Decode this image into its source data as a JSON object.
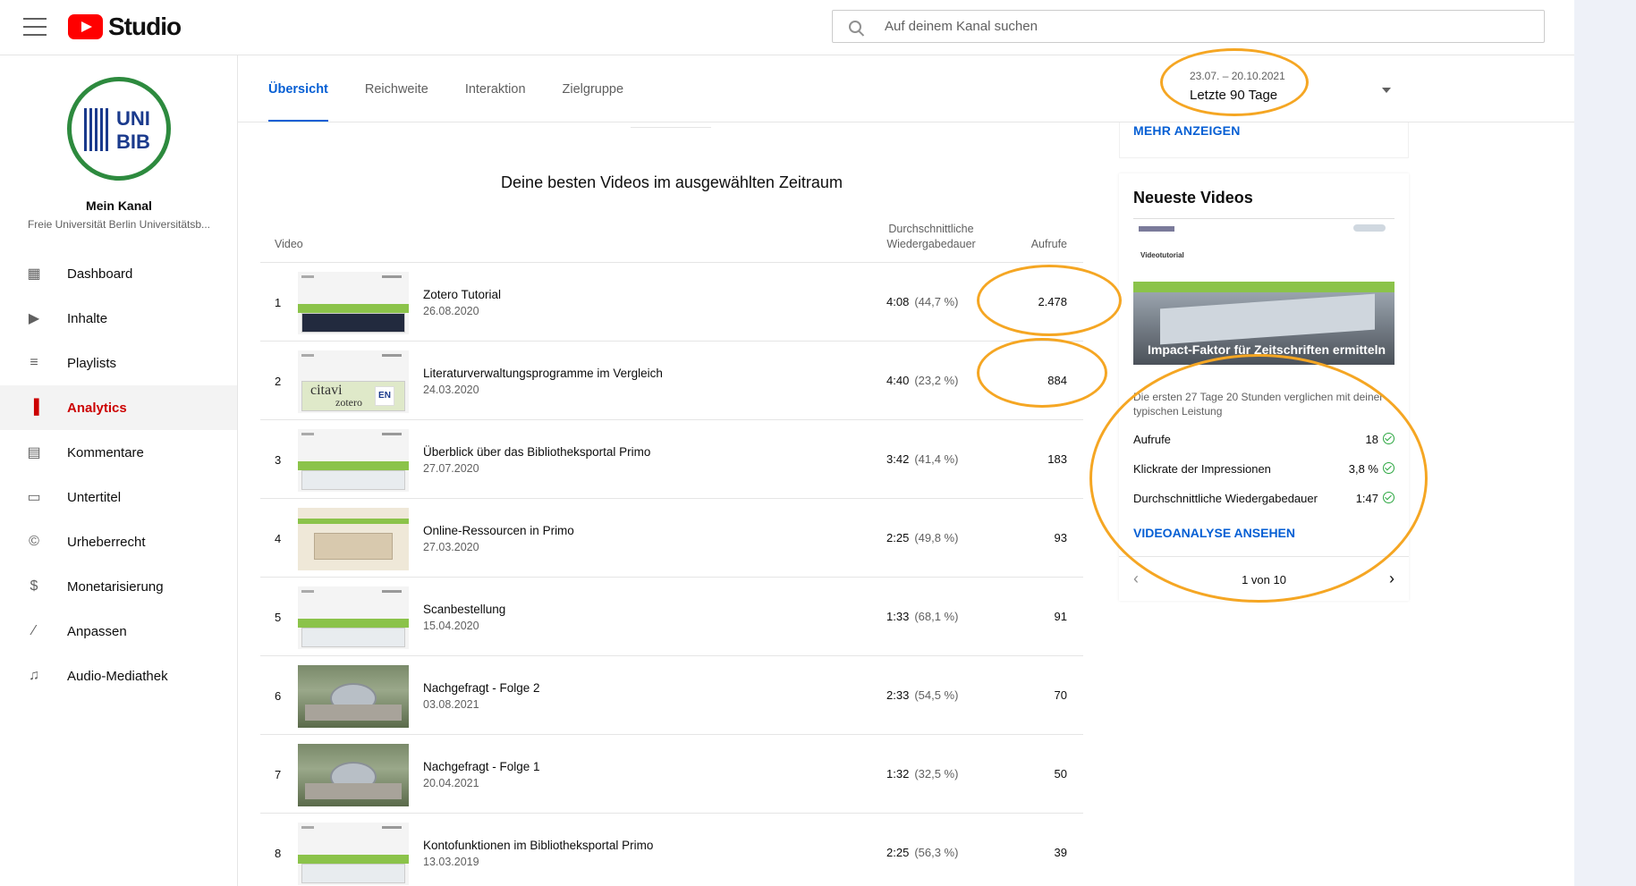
{
  "header": {
    "logo_text": "Studio",
    "search_placeholder": "Auf deinem Kanal suchen"
  },
  "sidebar": {
    "channel_title": "Mein Kanal",
    "channel_subtitle": "Freie Universität Berlin Universitätsb...",
    "avatar_text_top": "UNI",
    "avatar_text_bottom": "BIB",
    "items": [
      {
        "label": "Dashboard",
        "icon": "dashboard-icon",
        "glyph": "▦"
      },
      {
        "label": "Inhalte",
        "icon": "content-icon",
        "glyph": "▶"
      },
      {
        "label": "Playlists",
        "icon": "playlist-icon",
        "glyph": "≡"
      },
      {
        "label": "Analytics",
        "icon": "analytics-icon",
        "glyph": "▐"
      },
      {
        "label": "Kommentare",
        "icon": "comments-icon",
        "glyph": "▤"
      },
      {
        "label": "Untertitel",
        "icon": "subtitles-icon",
        "glyph": "▭"
      },
      {
        "label": "Urheberrecht",
        "icon": "copyright-icon",
        "glyph": "©"
      },
      {
        "label": "Monetarisierung",
        "icon": "dollar-icon",
        "glyph": "$"
      },
      {
        "label": "Anpassen",
        "icon": "magic-wand-icon",
        "glyph": "⁄"
      },
      {
        "label": "Audio-Mediathek",
        "icon": "audio-library-icon",
        "glyph": "♫"
      }
    ]
  },
  "tabs": [
    {
      "label": "Übersicht",
      "active": true
    },
    {
      "label": "Reichweite",
      "active": false
    },
    {
      "label": "Interaktion",
      "active": false
    },
    {
      "label": "Zielgruppe",
      "active": false
    }
  ],
  "date_picker": {
    "range": "23.07. – 20.10.2021",
    "label": "Letzte 90 Tage"
  },
  "top_videos": {
    "title": "Deine besten Videos im ausgewählten Zeitraum",
    "col_video": "Video",
    "col_duration": "Durchschnittliche Wiedergabedauer",
    "col_views": "Aufrufe",
    "rows": [
      {
        "idx": "1",
        "title": "Zotero Tutorial",
        "date": "26.08.2020",
        "duration": "4:08",
        "pct": "(44,7 %)",
        "views": "2.478",
        "thumb": "dark"
      },
      {
        "idx": "2",
        "title": "Literaturverwaltungsprogramme im Vergleich",
        "date": "24.03.2020",
        "duration": "4:40",
        "pct": "(23,2 %)",
        "views": "884",
        "thumb": "citavi",
        "thumb_text_1": "citavi",
        "thumb_text_2": "zotero",
        "thumb_badge": "EN"
      },
      {
        "idx": "3",
        "title": "Überblick über das Bibliotheksportal Primo",
        "date": "27.07.2020",
        "duration": "3:42",
        "pct": "(41,4 %)",
        "views": "183",
        "thumb": "slide"
      },
      {
        "idx": "4",
        "title": "Online-Ressourcen in Primo",
        "date": "27.03.2020",
        "duration": "2:25",
        "pct": "(49,8 %)",
        "views": "93",
        "thumb": "primo2"
      },
      {
        "idx": "5",
        "title": "Scanbestellung",
        "date": "15.04.2020",
        "duration": "1:33",
        "pct": "(68,1 %)",
        "views": "91",
        "thumb": "slide"
      },
      {
        "idx": "6",
        "title": "Nachgefragt - Folge 2",
        "date": "03.08.2021",
        "duration": "2:33",
        "pct": "(54,5 %)",
        "views": "70",
        "thumb": "photo"
      },
      {
        "idx": "7",
        "title": "Nachgefragt - Folge 1",
        "date": "20.04.2021",
        "duration": "1:32",
        "pct": "(32,5 %)",
        "views": "50",
        "thumb": "photo"
      },
      {
        "idx": "8",
        "title": "Kontofunktionen im Bibliotheksportal Primo",
        "date": "13.03.2019",
        "duration": "2:25",
        "pct": "(56,3 %)",
        "views": "39",
        "thumb": "slide"
      }
    ]
  },
  "right_panel": {
    "more_link": "MEHR ANZEIGEN",
    "latest_title": "Neueste Videos",
    "thumb_label": "Videotutorial",
    "thumb_caption": "Impact-Faktor für Zeitschriften ermitteln",
    "description": "Die ersten 27 Tage 20 Stunden verglichen mit deiner typischen Leistung",
    "metrics": [
      {
        "label": "Aufrufe",
        "value": "18"
      },
      {
        "label": "Klickrate der Impressionen",
        "value": "3,8 %"
      },
      {
        "label": "Durchschnittliche Wiedergabedauer",
        "value": "1:47"
      }
    ],
    "analysis_link": "VIDEOANALYSE ANSEHEN",
    "pager": "1 von 10",
    "prev": "‹",
    "next": "›"
  },
  "colors": {
    "accent": "#065fd4",
    "active_nav": "#cc0000",
    "annotation": "#f5a623",
    "ok": "#2ba640"
  }
}
